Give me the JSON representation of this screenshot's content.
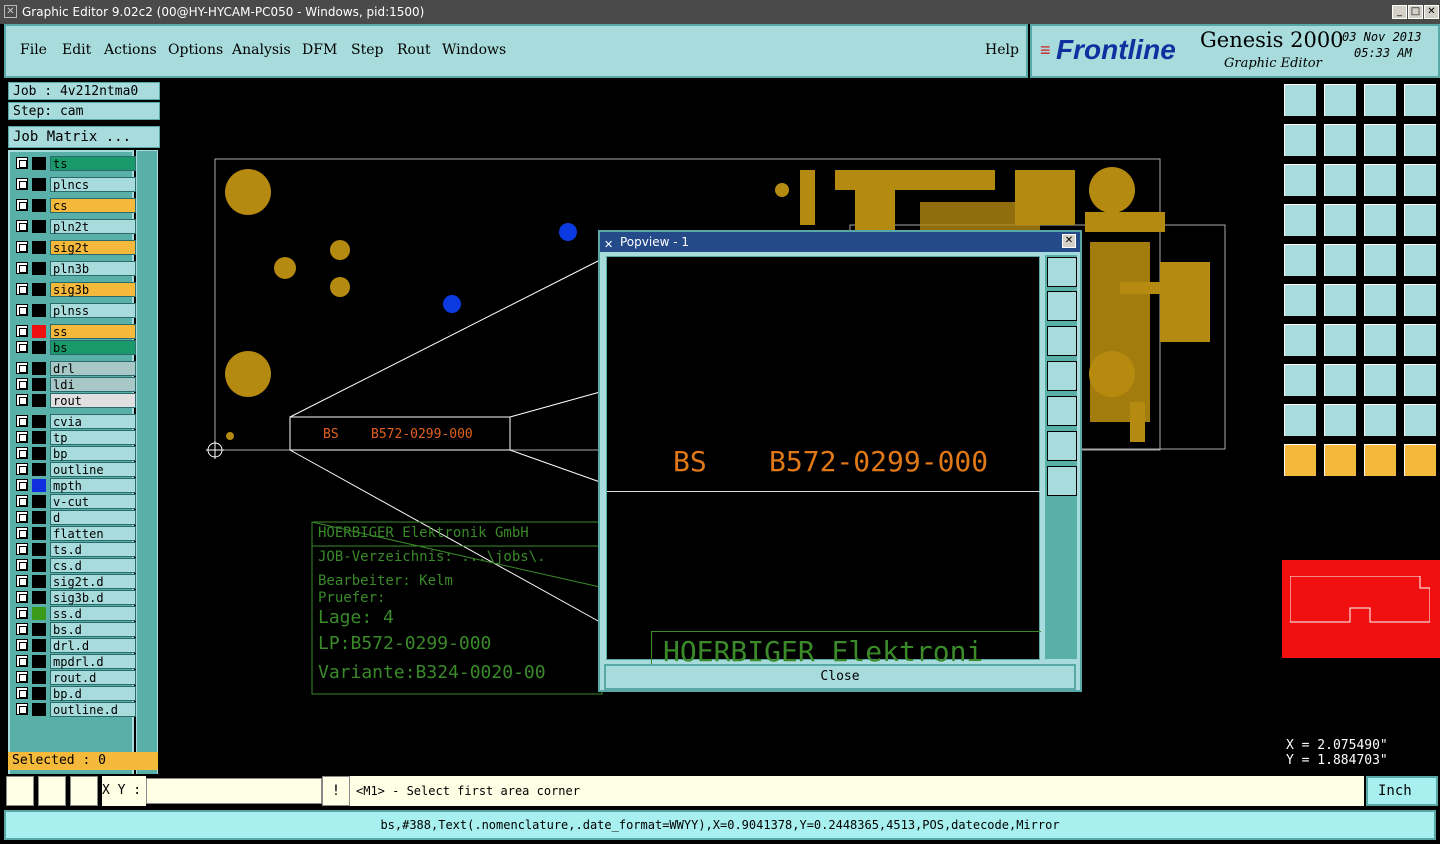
{
  "window": {
    "title": "Graphic Editor 9.02c2 (00@HY-HYCAM-PC050 - Windows, pid:1500)"
  },
  "menu": {
    "items": [
      "File",
      "Edit",
      "Actions",
      "Options",
      "Analysis",
      "DFM",
      "Step",
      "Rout",
      "Windows"
    ],
    "help": "Help"
  },
  "brand": {
    "logo": "Frontline",
    "product": "Genesis 2000",
    "subtitle": "Graphic Editor",
    "date": "03 Nov 2013",
    "time": "05:33 AM"
  },
  "job": {
    "job": "Job : 4v212ntma0",
    "step": "Step: cam",
    "matrix_button": "Job Matrix ..."
  },
  "layers": [
    {
      "name": "ts",
      "color": "#1a9a6a"
    },
    {
      "name": "plncs",
      "color": "#a8dcdc"
    },
    {
      "name": "cs",
      "color": "#f4b83a"
    },
    {
      "name": "pln2t",
      "color": "#a8dcdc"
    },
    {
      "name": "sig2t",
      "color": "#f4b83a"
    },
    {
      "name": "pln3b",
      "color": "#a8dcdc"
    },
    {
      "name": "sig3b",
      "color": "#f4b83a"
    },
    {
      "name": "plnss",
      "color": "#a8dcdc"
    },
    {
      "name": "ss",
      "color": "#f4b83a"
    },
    {
      "name": "bs",
      "color": "#1a9a6a"
    },
    {
      "name": "drl",
      "color": "#a8c8c8"
    },
    {
      "name": "ldi",
      "color": "#a8c8c8"
    },
    {
      "name": "rout",
      "color": "#e0e0e0"
    },
    {
      "name": "cvia",
      "color": "#a8dcdc"
    },
    {
      "name": "tp",
      "color": "#a8dcdc"
    },
    {
      "name": "bp",
      "color": "#a8dcdc"
    },
    {
      "name": "outline",
      "color": "#a8dcdc"
    },
    {
      "name": "mpth",
      "color": "#a8dcdc"
    },
    {
      "name": "v-cut",
      "color": "#a8dcdc"
    },
    {
      "name": "d",
      "color": "#a8dcdc"
    },
    {
      "name": "flatten",
      "color": "#a8dcdc"
    },
    {
      "name": "ts.d",
      "color": "#a8dcdc"
    },
    {
      "name": "cs.d",
      "color": "#a8dcdc"
    },
    {
      "name": "sig2t.d",
      "color": "#a8dcdc"
    },
    {
      "name": "sig3b.d",
      "color": "#a8dcdc"
    },
    {
      "name": "ss.d",
      "color": "#a8dcdc"
    },
    {
      "name": "bs.d",
      "color": "#a8dcdc"
    },
    {
      "name": "drl.d",
      "color": "#a8dcdc"
    },
    {
      "name": "mpdrl.d",
      "color": "#a8dcdc"
    },
    {
      "name": "rout.d",
      "color": "#a8dcdc"
    },
    {
      "name": "bp.d",
      "color": "#a8dcdc"
    },
    {
      "name": "outline.d",
      "color": "#a8dcdc"
    }
  ],
  "selected": "Selected : 0",
  "canvas": {
    "label_bs": "BS",
    "label_part": "B572-0299-000",
    "title_block": [
      "HOERBIGER Elektronik GmbH",
      "JOB-Verzeichnis: ...\\jobs\\.",
      "Bearbeiter: Kelm",
      "Pruefer:",
      "Lage:     4",
      "LP:B572-0299-000",
      "Variante:B324-0020-00"
    ]
  },
  "popview": {
    "title": "Popview - 1",
    "bs": "BS",
    "part": "B572-0299-000",
    "bottom_text": "HOERBIGER Elektroni",
    "close": "Close"
  },
  "coords": {
    "x": "X = 2.075490\"",
    "y": "Y = 1.884703\""
  },
  "bottom": {
    "xy_label": "X Y :",
    "prompt": "<M1> - Select first area corner",
    "units": "Inch"
  },
  "status": "bs,#388,Text(.nomenclature,.date_format=WWYY),X=0.9041378,Y=0.2448365,4513,POS,datecode,Mirror"
}
